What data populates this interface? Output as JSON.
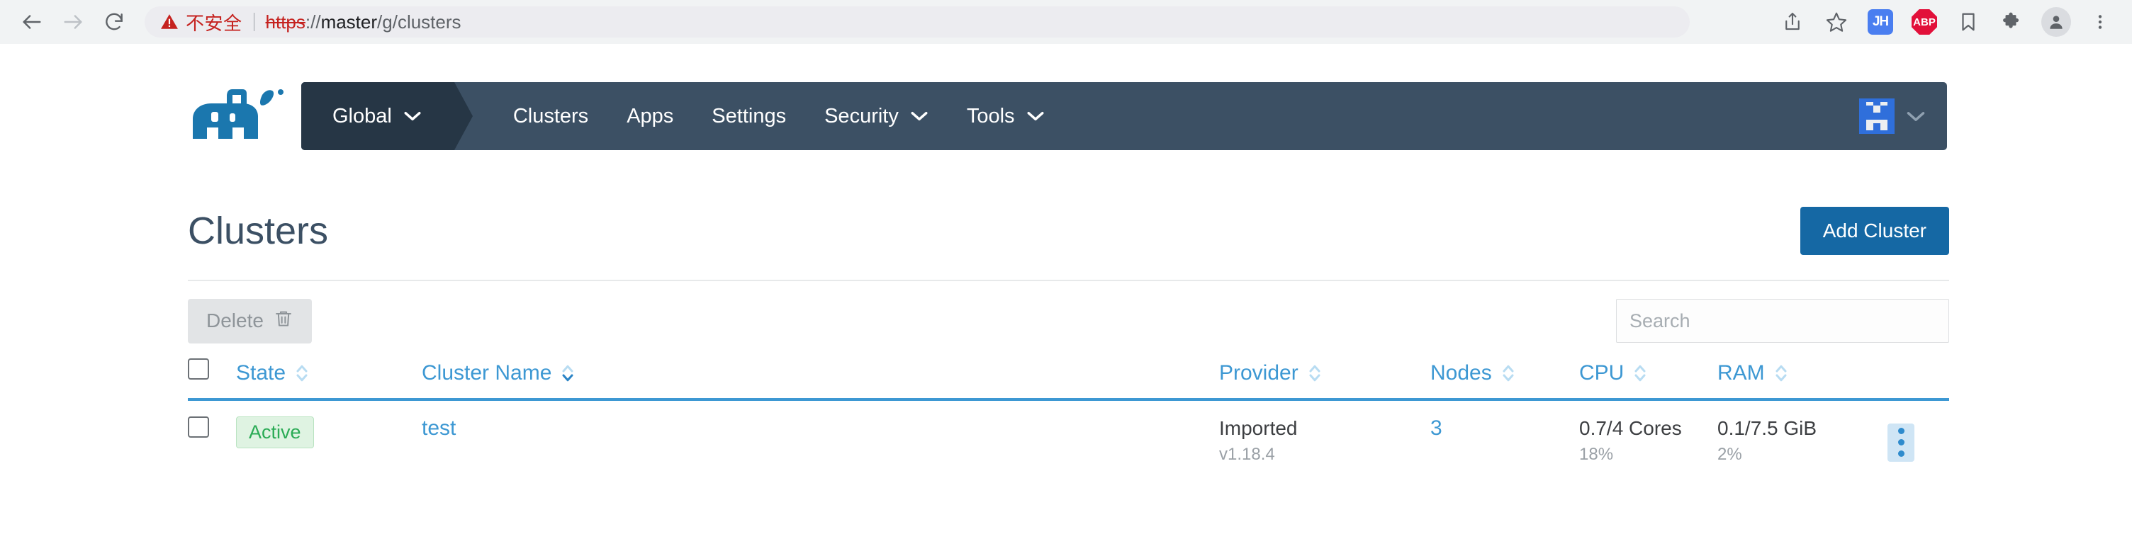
{
  "browser": {
    "back_icon": "arrow-left-icon",
    "forward_icon": "arrow-right-icon",
    "reload_icon": "reload-icon",
    "security_warning_icon": "warning-triangle-icon",
    "security_label": "不安全",
    "url_scheme": "https",
    "url_separator": "://",
    "url_host": "master",
    "url_path": "/g/clusters",
    "url_full": "https://master/g/clusters",
    "toolbar_icons": [
      {
        "name": "share-icon",
        "label": ""
      },
      {
        "name": "bookmark-star-icon",
        "label": ""
      },
      {
        "name": "extension-jh-icon",
        "label": "JH"
      },
      {
        "name": "extension-abp-icon",
        "label": "ABP"
      },
      {
        "name": "reading-list-icon",
        "label": ""
      },
      {
        "name": "extensions-puzzle-icon",
        "label": ""
      },
      {
        "name": "profile-avatar-icon",
        "label": ""
      },
      {
        "name": "chrome-menu-icon",
        "label": ""
      }
    ]
  },
  "nav": {
    "logo_name": "rancher-cow-logo",
    "scope_label": "Global",
    "scope_caret_icon": "chevron-down-icon",
    "items": [
      {
        "label": "Clusters",
        "has_caret": false
      },
      {
        "label": "Apps",
        "has_caret": false
      },
      {
        "label": "Settings",
        "has_caret": false
      },
      {
        "label": "Security",
        "has_caret": true
      },
      {
        "label": "Tools",
        "has_caret": true
      }
    ],
    "user_avatar_name": "user-identicon-avatar",
    "user_caret_icon": "chevron-down-icon"
  },
  "page": {
    "title": "Clusters",
    "add_cluster_label": "Add Cluster"
  },
  "controls": {
    "delete_label": "Delete",
    "delete_icon": "trash-icon",
    "delete_disabled": true,
    "search_placeholder": "Search",
    "search_value": ""
  },
  "table": {
    "columns": [
      {
        "key": "check",
        "label": "",
        "sortable": false,
        "sorted": false
      },
      {
        "key": "state",
        "label": "State",
        "sortable": true,
        "sorted": false
      },
      {
        "key": "name",
        "label": "Cluster Name",
        "sortable": true,
        "sorted": true,
        "sort_dir": "desc"
      },
      {
        "key": "provider",
        "label": "Provider",
        "sortable": true,
        "sorted": false
      },
      {
        "key": "nodes",
        "label": "Nodes",
        "sortable": true,
        "sorted": false
      },
      {
        "key": "cpu",
        "label": "CPU",
        "sortable": true,
        "sorted": false
      },
      {
        "key": "ram",
        "label": "RAM",
        "sortable": true,
        "sorted": false
      },
      {
        "key": "actions",
        "label": "",
        "sortable": false,
        "sorted": false
      }
    ],
    "rows": [
      {
        "state": "Active",
        "name": "test",
        "provider": "Imported",
        "provider_version": "v1.18.4",
        "nodes": "3",
        "cpu": "0.7/4 Cores",
        "cpu_percent": "18%",
        "ram": "0.1/7.5 GiB",
        "ram_percent": "2%",
        "actions_icon": "kebab-menu-icon"
      }
    ]
  },
  "colors": {
    "nav_bg": "#3c5064",
    "nav_scope_bg": "#263645",
    "accent": "#3d98d3",
    "primary_button": "#1568a4",
    "active_badge_text": "#2aab55",
    "active_badge_bg": "#dff3e2",
    "insecure_red": "#c5221f"
  }
}
